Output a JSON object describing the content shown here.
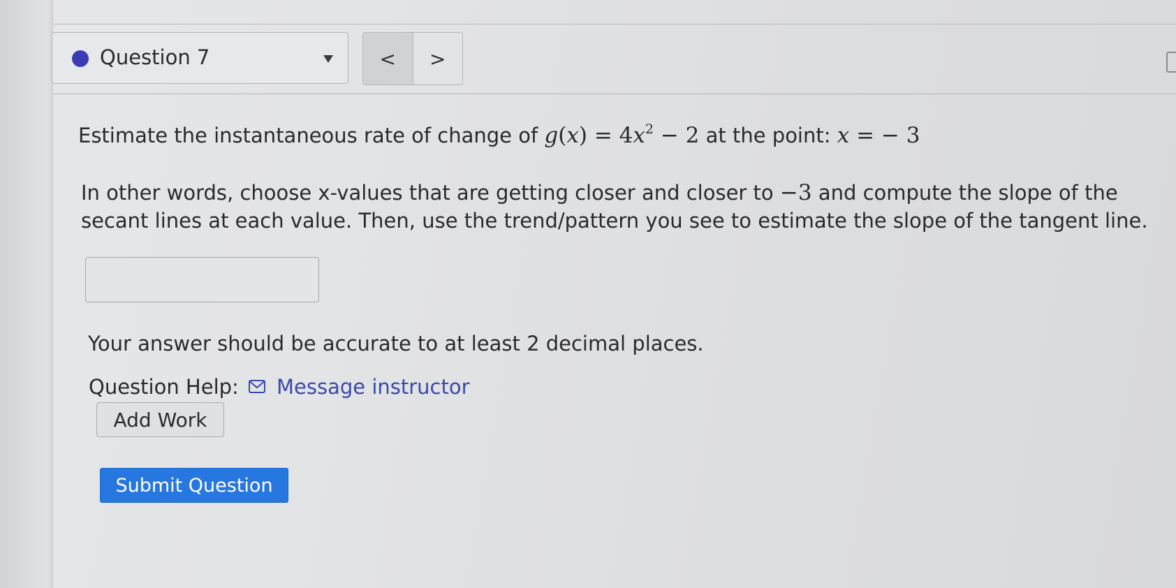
{
  "question_nav": {
    "label": "Question 7",
    "status_color": "#3b3bb8",
    "prev_label": "<",
    "next_label": ">"
  },
  "problem": {
    "intro": "Estimate the instantaneous rate of change of",
    "func_name": "g",
    "func_var": "x",
    "coef": "4",
    "exp": "2",
    "const": "− 2",
    "point_text": "at the point:",
    "point_var": "x",
    "point_value": "− 3",
    "para_before": "In other words, choose x-values that are getting closer and closer to",
    "para_value": "−3",
    "para_after": "and compute the slope of the secant lines at each value. Then, use the trend/pattern you see to estimate the slope of the tangent line."
  },
  "answer": {
    "value": "",
    "placeholder": ""
  },
  "accuracy_note": "Your answer should be accurate to at least 2 decimal places.",
  "help": {
    "label": "Question Help:",
    "icon": "envelope-icon",
    "message_label": "Message instructor"
  },
  "buttons": {
    "add_work": "Add Work",
    "submit": "Submit Question",
    "submit_color": "#2677e0"
  },
  "colors": {
    "link": "#3b4aa8"
  }
}
